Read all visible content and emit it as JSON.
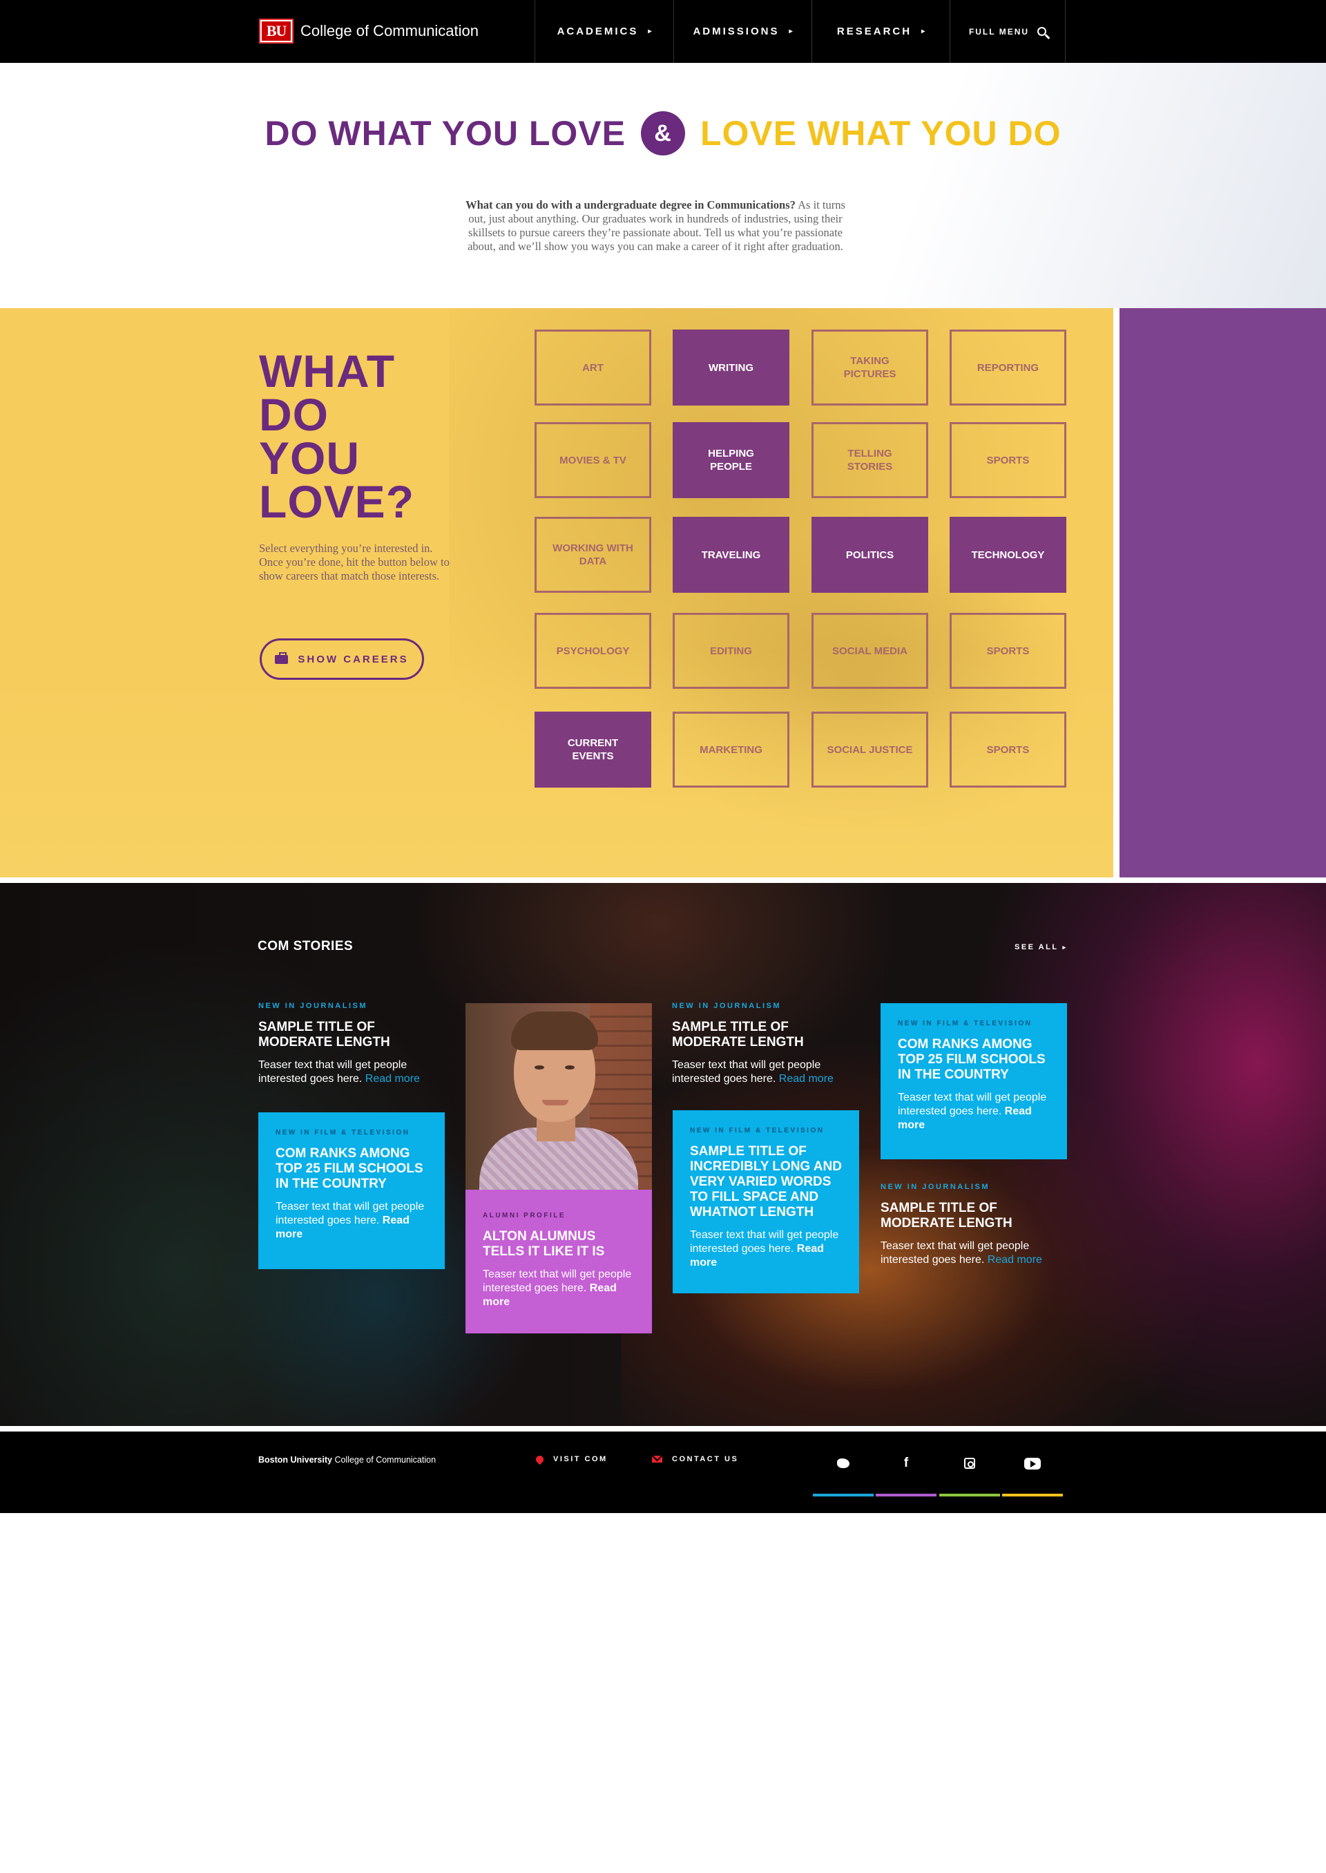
{
  "nav": {
    "logo_text": "BU",
    "college_name": "College of Communication",
    "items": [
      {
        "label": "ACADEMICS",
        "caret": "▸"
      },
      {
        "label": "ADMISSIONS",
        "caret": "▸"
      },
      {
        "label": "RESEARCH",
        "caret": "▸"
      }
    ],
    "full_menu_label": "FULL MENU",
    "search_icon": "search-icon"
  },
  "intro": {
    "headline_left": "DO WHAT YOU LOVE",
    "headline_amp": "&",
    "headline_right": "LOVE WHAT YOU DO",
    "lead_bold": "What can you do with a undergraduate degree in Communications?",
    "lead_rest": " As it turns out, just about anything. Our graduates work in hundreds of industries, using their skillsets to pursue careers they’re passionate about. Tell us what you’re passionate about, and we’ll show you ways you can make a career of it right after graduation."
  },
  "love": {
    "title_lines": [
      "WHAT",
      "DO",
      "YOU",
      "LOVE?"
    ],
    "description": "Select everything you’re interested in. Once you’re done, hit the button below to show careers that match those interests.",
    "button_label": "SHOW CAREERS",
    "button_icon": "briefcase-icon",
    "tiles": [
      {
        "label": "ART",
        "selected": false
      },
      {
        "label": "WRITING",
        "selected": true
      },
      {
        "label": "TAKING PICTURES",
        "selected": false
      },
      {
        "label": "REPORTING",
        "selected": false
      },
      {
        "label": "MOVIES & TV",
        "selected": false
      },
      {
        "label": "HELPING PEOPLE",
        "selected": true
      },
      {
        "label": "TELLING STORIES",
        "selected": false
      },
      {
        "label": "SPORTS",
        "selected": false
      },
      {
        "label": "WORKING WITH DATA",
        "selected": false
      },
      {
        "label": "TRAVELING",
        "selected": true
      },
      {
        "label": "POLITICS",
        "selected": true
      },
      {
        "label": "TECHNOLOGY",
        "selected": true
      },
      {
        "label": "PSYCHOLOGY",
        "selected": false
      },
      {
        "label": "EDITING",
        "selected": false
      },
      {
        "label": "SOCIAL MEDIA",
        "selected": false
      },
      {
        "label": "SPORTS",
        "selected": false
      },
      {
        "label": "CURRENT EVENTS",
        "selected": true
      },
      {
        "label": "MARKETING",
        "selected": false
      },
      {
        "label": "SOCIAL JUSTICE",
        "selected": false
      },
      {
        "label": "SPORTS",
        "selected": false
      }
    ]
  },
  "stories": {
    "section_title": "COM STORIES",
    "see_all": "SEE ALL",
    "read_more": "Read more",
    "col1_plain": {
      "kicker": "NEW IN JOURNALISM",
      "title": "SAMPLE TITLE OF MODERATE LENGTH",
      "teaser": "Teaser text that will get people interested goes here."
    },
    "col1_card": {
      "kicker": "NEW IN FILM & TELEVISION",
      "title": "COM RANKS AMONG TOP 25 FILM SCHOOLS IN THE COUNTRY",
      "teaser": "Teaser text that will get people interested goes here."
    },
    "profile": {
      "kicker": "ALUMNI PROFILE",
      "title": "ALTON ALUMNUS TELLS IT LIKE IT IS",
      "teaser": "Teaser text that will get people interested goes here."
    },
    "col3_plain": {
      "kicker": "NEW IN JOURNALISM",
      "title": "SAMPLE TITLE OF MODERATE LENGTH",
      "teaser": "Teaser text that will get people interested goes here."
    },
    "col3_card": {
      "kicker": "NEW IN FILM & TELEVISION",
      "title": "SAMPLE TITLE OF INCREDIBLY LONG AND VERY VARIED WORDS TO FILL SPACE AND WHATNOT LENGTH",
      "teaser": "Teaser text that will get people interested goes here."
    },
    "col4_card": {
      "kicker": "NEW IN FILM & TELEVISION",
      "title": "COM RANKS AMONG TOP 25 FILM SCHOOLS IN THE COUNTRY",
      "teaser": "Teaser text that will get people interested goes here."
    },
    "col4_plain": {
      "kicker": "NEW IN JOURNALISM",
      "title": "SAMPLE TITLE OF MODERATE LENGTH",
      "teaser": "Teaser text that will get people interested goes here."
    }
  },
  "footer": {
    "brand_bold": "Boston University",
    "brand_rest": " College of Communication",
    "visit": "VISIT COM",
    "contact": "CONTACT US",
    "social_icons": [
      "twitter-icon",
      "facebook-icon",
      "instagram-icon",
      "youtube-icon"
    ],
    "facebook_glyph": "f",
    "bar_colors": [
      "#1aa6dc",
      "#b05cd0",
      "#8dc63f",
      "#f4c21c"
    ]
  },
  "colors": {
    "purple": "#6a2a7e",
    "yellow": "#f4c21c",
    "blue": "#0ab0e8",
    "tile_selected": "#7e3b7e",
    "side_purple": "#7e438e"
  }
}
